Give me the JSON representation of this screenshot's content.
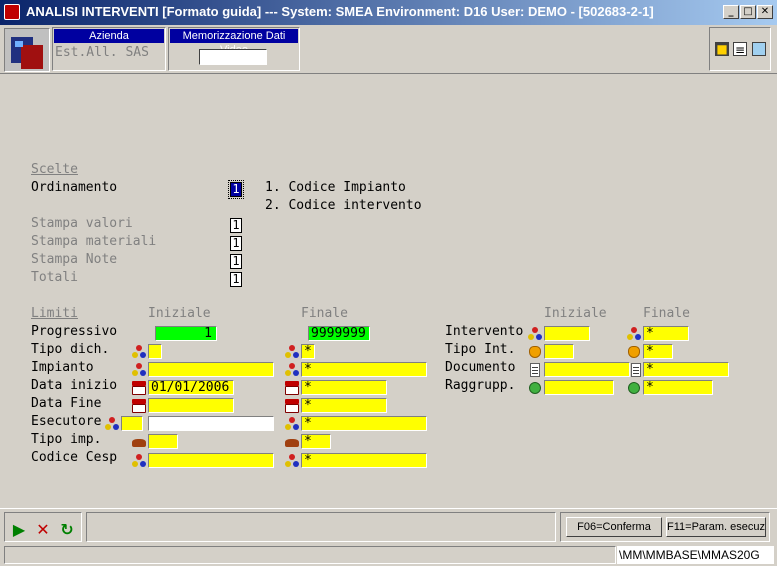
{
  "window": {
    "title": "ANALISI INTERVENTI [Formato guida] --- System: SMEA Environment: D16 User: DEMO - [502683-2-1]",
    "min_glyph": "_",
    "max_glyph": "□",
    "close_glyph": "✕"
  },
  "toolbar": {
    "azienda_label": "Azienda",
    "azienda_value": "Est.All. SAS",
    "memo_label": "Memorizzazione Dati Video",
    "memo_value": "",
    "icons": [
      "monitor-icon",
      "notes-icon",
      "document-icon"
    ]
  },
  "scelte": {
    "header": "Scelte",
    "ordinamento_label": "Ordinamento",
    "ordinamento_value": "1",
    "options": [
      "1. Codice Impianto",
      "2. Codice intervento"
    ],
    "stampa_valori_label": "Stampa valori",
    "stampa_valori_value": "1",
    "stampa_materiali_label": "Stampa materiali",
    "stampa_materiali_value": "1",
    "stampa_note_label": "Stampa Note",
    "stampa_note_value": "1",
    "totali_label": "Totali",
    "totali_value": "1"
  },
  "limiti": {
    "header": "Limiti",
    "iniziale": "Iniziale",
    "finale": "Finale",
    "left_rows": [
      {
        "label": "Progressivo",
        "start": "1",
        "end": "9999999"
      },
      {
        "label": "Tipo dich.",
        "start": "",
        "end": "*"
      },
      {
        "label": "Impianto",
        "start": "",
        "end": "*"
      },
      {
        "label": "Data inizio",
        "start": "01/01/2006",
        "end": "*"
      },
      {
        "label": "Data Fine",
        "start": "",
        "end": "*"
      },
      {
        "label": "Esecutore",
        "start_code": "",
        "start": "",
        "end": "*"
      },
      {
        "label": "Tipo imp.",
        "start": "",
        "end": "*"
      },
      {
        "label": "Codice Cesp",
        "start": "",
        "end": "*"
      }
    ],
    "right_iniziale": "Iniziale",
    "right_finale": "Finale",
    "right_rows": [
      {
        "label": "Intervento",
        "start": "",
        "end": "*"
      },
      {
        "label": "Tipo Int.",
        "start": "",
        "end": "*"
      },
      {
        "label": "Documento",
        "start": "",
        "end": "*"
      },
      {
        "label": "Raggrupp.",
        "start": "",
        "end": "*"
      }
    ]
  },
  "bottom": {
    "conferma_label": "F06=Conferma",
    "param_label": "F11=Param. esecuz",
    "play_glyph": "▶",
    "cancel_glyph": "✕",
    "refresh_glyph": "↻"
  },
  "status": {
    "left": "",
    "path": "\\MM\\MMBASE\\MMAS20G"
  },
  "colors": {
    "title_start": "#0a246a",
    "field_yellow": "#ffff00",
    "field_green": "#00ff00",
    "header_blue": "#0000a0"
  }
}
